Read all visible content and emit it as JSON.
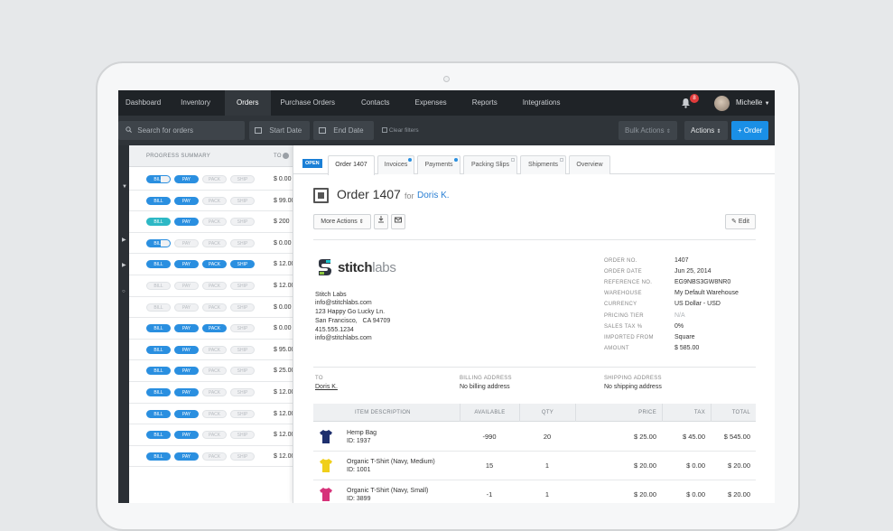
{
  "nav": {
    "items": [
      "Dashboard",
      "Inventory",
      "Orders",
      "Purchase Orders",
      "Contacts",
      "Expenses",
      "Reports",
      "Integrations"
    ],
    "active": "Orders",
    "bell_count": "8",
    "user": "Michelle"
  },
  "subbar": {
    "search_placeholder": "Search for orders",
    "start_date": "Start Date",
    "end_date": "End Date",
    "clear_filters": "Clear filters",
    "bulk_actions": "Bulk Actions",
    "actions": "Actions",
    "new_order": "+ Order"
  },
  "grid": {
    "headers": [
      "PROGRESS SUMMARY",
      "TO"
    ],
    "pill_labels": [
      "BILL",
      "PAY",
      "PACK",
      "SHIP"
    ],
    "rows": [
      {
        "state": [
          "half",
          "on",
          "off",
          "off"
        ],
        "amount": "$ 0.00"
      },
      {
        "state": [
          "on",
          "on",
          "off",
          "off"
        ],
        "amount": "$ 99.00"
      },
      {
        "state": [
          "teal",
          "on",
          "off",
          "off"
        ],
        "amount": "$ 200"
      },
      {
        "state": [
          "half",
          "off",
          "off",
          "off"
        ],
        "amount": "$ 0.00"
      },
      {
        "state": [
          "on",
          "on",
          "on",
          "on"
        ],
        "amount": "$ 12.00"
      },
      {
        "state": [
          "off",
          "off",
          "off",
          "off"
        ],
        "amount": "$ 12.00"
      },
      {
        "state": [
          "off",
          "off",
          "off",
          "off"
        ],
        "amount": "$ 0.00"
      },
      {
        "state": [
          "on",
          "on",
          "on",
          "off"
        ],
        "amount": "$ 0.00"
      },
      {
        "state": [
          "on",
          "on",
          "off",
          "off"
        ],
        "amount": "$ 95.00"
      },
      {
        "state": [
          "on",
          "on",
          "off",
          "off"
        ],
        "amount": "$ 25.00"
      },
      {
        "state": [
          "on",
          "on",
          "off",
          "off"
        ],
        "amount": "$ 12.00"
      },
      {
        "state": [
          "on",
          "on",
          "off",
          "off"
        ],
        "amount": "$ 12.00"
      },
      {
        "state": [
          "on",
          "on",
          "off",
          "off"
        ],
        "amount": "$ 12.00"
      },
      {
        "state": [
          "on",
          "on",
          "off",
          "off"
        ],
        "amount": "$ 12.00"
      }
    ]
  },
  "detail": {
    "status": "OPEN",
    "tabs": [
      "Order 1407",
      "Invoices",
      "Payments",
      "Packing Slips",
      "Shipments",
      "Overview"
    ],
    "title": "Order 1407",
    "for_label": "for",
    "customer": "Doris K.",
    "more_actions": "More Actions",
    "edit": "Edit",
    "logo_text_a": "stitch",
    "logo_text_b": "labs",
    "company": {
      "name": "Stitch Labs",
      "email": "info@stitchlabs.com",
      "street": "123 Happy Go Lucky Ln.",
      "city": "San Francisco,   CA 94709",
      "phone": "415.555.1234",
      "email2": "info@stitchlabs.com"
    },
    "fields": [
      {
        "label": "ORDER NO.",
        "value": "1407"
      },
      {
        "label": "ORDER DATE",
        "value": "Jun 25, 2014"
      },
      {
        "label": "REFERENCE NO.",
        "value": "EG9NBS3GW8NR0"
      },
      {
        "label": "WAREHOUSE",
        "value": "My Default Warehouse"
      },
      {
        "label": "CURRENCY",
        "value": "US Dollar - USD"
      },
      {
        "label": "PRICING TIER",
        "value": "N/A"
      },
      {
        "label": "SALES TAX %",
        "value": "0%"
      },
      {
        "label": "IMPORTED FROM",
        "value": "Square"
      },
      {
        "label": "AMOUNT",
        "value": "$ 585.00"
      }
    ],
    "to_label": "TO",
    "to_value": "Doris K.",
    "billing_label": "BILLING ADDRESS",
    "billing_value": "No billing address",
    "shipping_label": "SHIPPING ADDRESS",
    "shipping_value": "No shipping address",
    "item_headers": [
      "ITEM DESCRIPTION",
      "AVAILABLE",
      "QTY",
      "PRICE",
      "TAX",
      "TOTAL"
    ],
    "items": [
      {
        "name": "Hemp Bag",
        "id": "ID: 1937",
        "available": "-990",
        "qty": "20",
        "price": "$ 25.00",
        "tax": "$ 45.00",
        "total": "$ 545.00",
        "color": "#1e2f6e"
      },
      {
        "name": "Organic T-Shirt (Navy, Medium)",
        "id": "ID: 1001",
        "available": "15",
        "qty": "1",
        "price": "$ 20.00",
        "tax": "$ 0.00",
        "total": "$ 20.00",
        "color": "#f0cf1a"
      },
      {
        "name": "Organic T-Shirt (Navy, Small)",
        "id": "ID: 3899",
        "available": "-1",
        "qty": "1",
        "price": "$ 20.00",
        "tax": "$ 0.00",
        "total": "$ 20.00",
        "color": "#d6337a"
      }
    ]
  }
}
